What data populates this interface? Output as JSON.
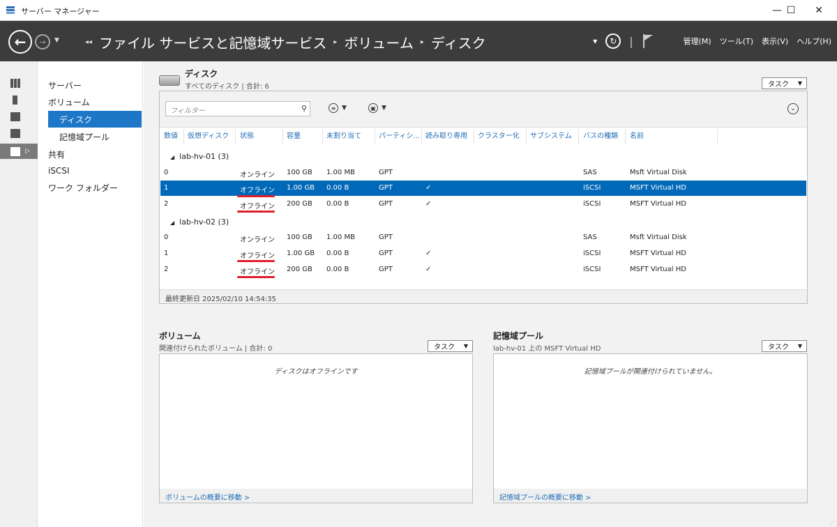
{
  "window": {
    "title": "サーバー マネージャー",
    "minimize": "—",
    "maximize": "☐",
    "close": "✕"
  },
  "header": {
    "breadcrumb": [
      "ファイル サービスと記憶域サービス",
      "ボリューム",
      "ディスク"
    ],
    "menus": [
      "管理(M)",
      "ツール(T)",
      "表示(V)",
      "ヘルプ(H)"
    ]
  },
  "nav": {
    "items": [
      "サーバー",
      "ボリューム",
      "ディスク",
      "記憶域プール",
      "共有",
      "iSCSI",
      "ワーク フォルダー"
    ]
  },
  "disks": {
    "title": "ディスク",
    "subtitle": "すべてのディスク | 合計: 6",
    "task_label": "タスク",
    "filter_placeholder": "フィルター",
    "columns": [
      "数値",
      "仮想ディスク",
      "状態",
      "容量",
      "未割り当て",
      "パーティシ...",
      "読み取り専用",
      "クラスター化",
      "サブシステム",
      "バスの種類",
      "名前"
    ],
    "groups": [
      {
        "name": "lab-hv-01 (3)",
        "rows": [
          {
            "num": "0",
            "status": "オンライン",
            "capacity": "100 GB",
            "unalloc": "1.00 MB",
            "part": "GPT",
            "ro": "",
            "bus": "SAS",
            "name": "Msft Virtual Disk"
          },
          {
            "num": "1",
            "status": "オフライン",
            "capacity": "1.00 GB",
            "unalloc": "0.00 B",
            "part": "GPT",
            "ro": "✓",
            "bus": "iSCSI",
            "name": "MSFT Virtual HD"
          },
          {
            "num": "2",
            "status": "オフライン",
            "capacity": "200 GB",
            "unalloc": "0.00 B",
            "part": "GPT",
            "ro": "✓",
            "bus": "iSCSI",
            "name": "MSFT Virtual HD"
          }
        ]
      },
      {
        "name": "lab-hv-02 (3)",
        "rows": [
          {
            "num": "0",
            "status": "オンライン",
            "capacity": "100 GB",
            "unalloc": "1.00 MB",
            "part": "GPT",
            "ro": "",
            "bus": "SAS",
            "name": "Msft Virtual Disk"
          },
          {
            "num": "1",
            "status": "オフライン",
            "capacity": "1.00 GB",
            "unalloc": "0.00 B",
            "part": "GPT",
            "ro": "✓",
            "bus": "iSCSI",
            "name": "MSFT Virtual HD"
          },
          {
            "num": "2",
            "status": "オフライン",
            "capacity": "200 GB",
            "unalloc": "0.00 B",
            "part": "GPT",
            "ro": "✓",
            "bus": "iSCSI",
            "name": "MSFT Virtual HD"
          }
        ]
      }
    ],
    "last_updated": "最終更新日 2025/02/10 14:54:35"
  },
  "volumes": {
    "title": "ボリューム",
    "subtitle": "関連付けられたボリューム | 合計: 0",
    "task_label": "タスク",
    "message": "ディスクはオフラインです",
    "link": "ボリュームの概要に移動 >"
  },
  "pools": {
    "title": "記憶域プール",
    "subtitle": "lab-hv-01 上の MSFT Virtual HD",
    "task_label": "タスク",
    "message": "記憶域プールが関連付けられていません。",
    "link": "記憶域プールの概要に移動 >"
  },
  "colors": {
    "accent": "#1e77c6",
    "selected_row": "#0068b8",
    "header_bg": "#3c3c3c",
    "annotation": "#e01e2a"
  }
}
